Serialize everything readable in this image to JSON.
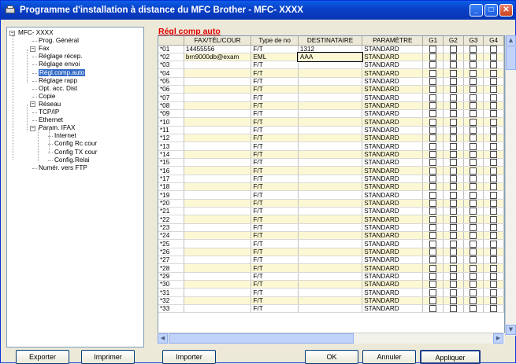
{
  "window": {
    "title": "Programme d'installation à distance du MFC Brother - MFC- XXXX"
  },
  "tree": [
    {
      "label": "MFC- XXXX",
      "level": 0,
      "expander": "−"
    },
    {
      "label": "Prog. Général",
      "level": 1
    },
    {
      "label": "Fax",
      "level": 1,
      "expander": "−"
    },
    {
      "label": "Réglage récep.",
      "level": 2
    },
    {
      "label": "Réglage envoi",
      "level": 2
    },
    {
      "label": "Régl.comp.auto",
      "level": 2,
      "selected": true
    },
    {
      "label": "Réglage rapp",
      "level": 2
    },
    {
      "label": "Opt. acc. Dist",
      "level": 2
    },
    {
      "label": "Copie",
      "level": 1
    },
    {
      "label": "Réseau",
      "level": 1,
      "expander": "−"
    },
    {
      "label": "TCP/IP",
      "level": 2
    },
    {
      "label": "Ethernet",
      "level": 2
    },
    {
      "label": "Param. IFAX",
      "level": 2,
      "expander": "−"
    },
    {
      "label": "Internet",
      "level": 3
    },
    {
      "label": "Config Rc cour",
      "level": 3
    },
    {
      "label": "Config TX cour",
      "level": 3
    },
    {
      "label": "Config.Relai",
      "level": 3
    },
    {
      "label": "Numér. vers FTP",
      "level": 2
    }
  ],
  "main": {
    "heading": "Régl comp auto"
  },
  "table": {
    "headers": [
      "",
      "FAX/TÉL/COUR",
      "Type de no",
      "DESTINATAIRE",
      "PARAMÈTRE",
      "G1",
      "G2",
      "G3",
      "G4"
    ],
    "rows": [
      [
        "*01",
        "14455556",
        "F/T",
        "1312",
        "STANDARD"
      ],
      [
        "*02",
        "brn9000db@exam",
        "EML",
        "AAA",
        "STANDARD"
      ],
      [
        "*03",
        "",
        "F/T",
        "",
        "STANDARD"
      ],
      [
        "*04",
        "",
        "F/T",
        "",
        "STANDARD"
      ],
      [
        "*05",
        "",
        "F/T",
        "",
        "STANDARD"
      ],
      [
        "*06",
        "",
        "F/T",
        "",
        "STANDARD"
      ],
      [
        "*07",
        "",
        "F/T",
        "",
        "STANDARD"
      ],
      [
        "*08",
        "",
        "F/T",
        "",
        "STANDARD"
      ],
      [
        "*09",
        "",
        "F/T",
        "",
        "STANDARD"
      ],
      [
        "*10",
        "",
        "F/T",
        "",
        "STANDARD"
      ],
      [
        "*11",
        "",
        "F/T",
        "",
        "STANDARD"
      ],
      [
        "*12",
        "",
        "F/T",
        "",
        "STANDARD"
      ],
      [
        "*13",
        "",
        "F/T",
        "",
        "STANDARD"
      ],
      [
        "*14",
        "",
        "F/T",
        "",
        "STANDARD"
      ],
      [
        "*15",
        "",
        "F/T",
        "",
        "STANDARD"
      ],
      [
        "*16",
        "",
        "F/T",
        "",
        "STANDARD"
      ],
      [
        "*17",
        "",
        "F/T",
        "",
        "STANDARD"
      ],
      [
        "*18",
        "",
        "F/T",
        "",
        "STANDARD"
      ],
      [
        "*19",
        "",
        "F/T",
        "",
        "STANDARD"
      ],
      [
        "*20",
        "",
        "F/T",
        "",
        "STANDARD"
      ],
      [
        "*21",
        "",
        "F/T",
        "",
        "STANDARD"
      ],
      [
        "*22",
        "",
        "F/T",
        "",
        "STANDARD"
      ],
      [
        "*23",
        "",
        "F/T",
        "",
        "STANDARD"
      ],
      [
        "*24",
        "",
        "F/T",
        "",
        "STANDARD"
      ],
      [
        "*25",
        "",
        "F/T",
        "",
        "STANDARD"
      ],
      [
        "*26",
        "",
        "F/T",
        "",
        "STANDARD"
      ],
      [
        "*27",
        "",
        "F/T",
        "",
        "STANDARD"
      ],
      [
        "*28",
        "",
        "F/T",
        "",
        "STANDARD"
      ],
      [
        "*29",
        "",
        "F/T",
        "",
        "STANDARD"
      ],
      [
        "*30",
        "",
        "F/T",
        "",
        "STANDARD"
      ],
      [
        "*31",
        "",
        "F/T",
        "",
        "STANDARD"
      ],
      [
        "*32",
        "",
        "F/T",
        "",
        "STANDARD"
      ],
      [
        "*33",
        "",
        "F/T",
        "",
        "STANDARD"
      ]
    ]
  },
  "buttons": {
    "export": "Exporter",
    "print": "Imprimer",
    "import": "Importer",
    "ok": "OK",
    "cancel": "Annuler",
    "apply": "Appliquer"
  },
  "colors": {
    "row_even": "#fdf8d4",
    "selection": "#316ac5",
    "heading": "#e00000",
    "titlebar": "#0a4fd6"
  }
}
